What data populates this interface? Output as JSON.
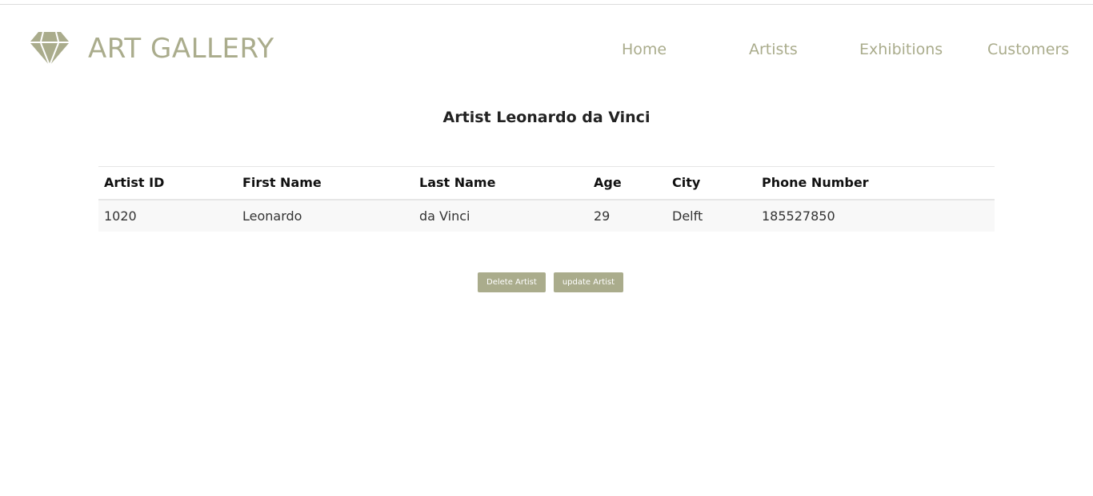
{
  "header": {
    "brand": "ART GALLERY",
    "brand_icon": "diamond-icon",
    "accent_color": "#aaac8c",
    "nav": {
      "home": "Home",
      "artists": "Artists",
      "exhibitions": "Exhibitions",
      "customers": "Customers"
    }
  },
  "main": {
    "title": "Artist Leonardo da Vinci",
    "table": {
      "columns": [
        "Artist ID",
        "First Name",
        "Last Name",
        "Age",
        "City",
        "Phone Number"
      ],
      "rows": [
        [
          "1020",
          "Leonardo",
          "da Vinci",
          "29",
          "Delft",
          "185527850"
        ]
      ]
    },
    "actions": {
      "delete_label": "Delete Artist",
      "update_label": "update Artist"
    }
  }
}
